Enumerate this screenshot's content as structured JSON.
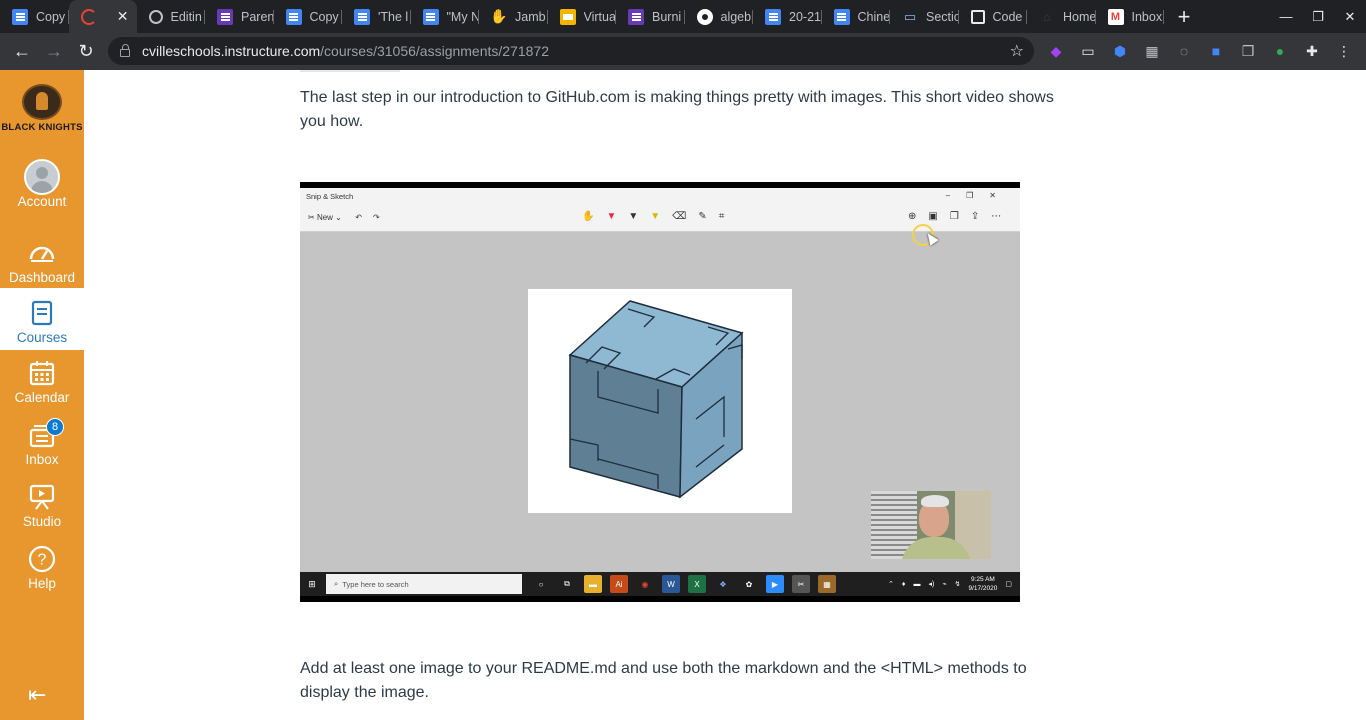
{
  "tabs": [
    {
      "title": "Copy",
      "icon": "google-docs-icon",
      "fav": "doc",
      "active": false
    },
    {
      "title": "",
      "icon": "loading-icon",
      "fav": "loading",
      "active": true,
      "close": "✕"
    },
    {
      "title": "Editin",
      "icon": "github-icon",
      "fav": "gh",
      "active": false
    },
    {
      "title": "Paren",
      "icon": "google-forms-icon",
      "fav": "form",
      "active": false
    },
    {
      "title": "Copy",
      "icon": "google-docs-icon",
      "fav": "doc",
      "active": false
    },
    {
      "title": "'The l",
      "icon": "google-docs-icon",
      "fav": "doc",
      "active": false
    },
    {
      "title": "\"My N",
      "icon": "google-docs-icon",
      "fav": "doc",
      "active": false
    },
    {
      "title": "Jamb",
      "icon": "jamboard-icon",
      "fav": "jamboard",
      "active": false
    },
    {
      "title": "Virtua",
      "icon": "google-slides-icon",
      "fav": "slides",
      "active": false
    },
    {
      "title": "Burni",
      "icon": "google-forms-icon",
      "fav": "form",
      "active": false
    },
    {
      "title": "algeb",
      "icon": "algebra-icon",
      "fav": "algebra",
      "active": false
    },
    {
      "title": "20-21",
      "icon": "google-docs-icon",
      "fav": "doc",
      "active": false
    },
    {
      "title": "Chine",
      "icon": "google-docs-icon",
      "fav": "doc",
      "active": false
    },
    {
      "title": "Sectio",
      "icon": "monitor-icon",
      "fav": "section",
      "active": false
    },
    {
      "title": "Code",
      "icon": "code-icon",
      "fav": "code",
      "active": false
    },
    {
      "title": "Home",
      "icon": "home-icon",
      "fav": "home",
      "active": false
    },
    {
      "title": "Inbox",
      "icon": "gmail-icon",
      "fav": "gmail",
      "active": false
    }
  ],
  "url": {
    "host": "cvilleschools.instructure.com",
    "path": "/courses/31056/assignments/271872"
  },
  "sidebar": {
    "logo_text": "BLACK KNIGHTS",
    "items": [
      {
        "label": "Account",
        "icon": "account-avatar-icon"
      },
      {
        "label": "Dashboard",
        "icon": "dashboard-icon"
      },
      {
        "label": "Courses",
        "icon": "courses-icon",
        "active": true
      },
      {
        "label": "Calendar",
        "icon": "calendar-icon"
      },
      {
        "label": "Inbox",
        "icon": "inbox-icon",
        "badge": "8"
      },
      {
        "label": "Studio",
        "icon": "studio-icon"
      },
      {
        "label": "Help",
        "icon": "help-icon"
      }
    ]
  },
  "content": {
    "intro": "The last step in our introduction to GitHub.com is making things pretty with images.  This short video shows you how.",
    "instruction": "Add at least one image to your README.md and use both the markdown and the <HTML> methods to display the image."
  },
  "video": {
    "window_title": "Snip & Sketch",
    "new_label": "New",
    "search_placeholder": "Type here to search",
    "time": "9:25 AM",
    "date": "9/17/2020"
  },
  "colors": {
    "canvas_orange": "#e8962e",
    "canvas_blue": "#2b7abc",
    "badge_blue": "#0b7ad1",
    "chrome_dark": "#202124"
  }
}
